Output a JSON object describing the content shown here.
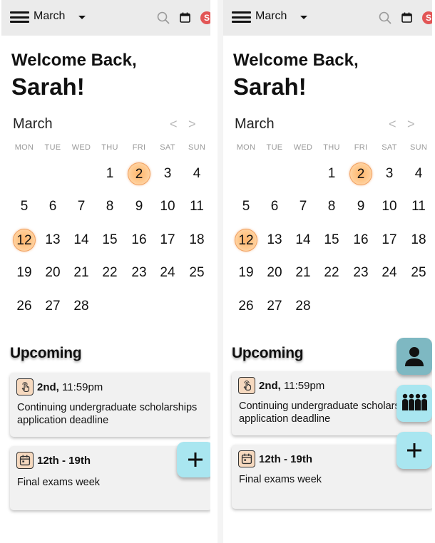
{
  "header": {
    "month_label": "March"
  },
  "greeting": {
    "line1": "Welcome Back,",
    "name": "Sarah!"
  },
  "avatar_initial": "S",
  "calendar": {
    "month": "March",
    "prev_arrow": "<",
    "next_arrow": ">",
    "weekdays": [
      "MON",
      "TUE",
      "WED",
      "THU",
      "FRI",
      "SAT",
      "SUN"
    ],
    "first_weekday_index": 3,
    "days_in_month": 28,
    "marked_days": [
      2,
      12
    ],
    "marked_color": "#ffb56b"
  },
  "upcoming": {
    "title": "Upcoming",
    "events": [
      {
        "icon": "hand-touch-icon",
        "date_bold": "2nd,",
        "time": "11:59pm",
        "title": "Continuing undergraduate scholarships application deadline"
      },
      {
        "icon": "calendar-icon",
        "date_bold": "12th - 19th",
        "time": "",
        "title": "Final exams week"
      }
    ]
  },
  "fab": {
    "color": "#a9e6f0",
    "add": "plus-icon",
    "profile": "person-icon",
    "group": "group-icon"
  }
}
